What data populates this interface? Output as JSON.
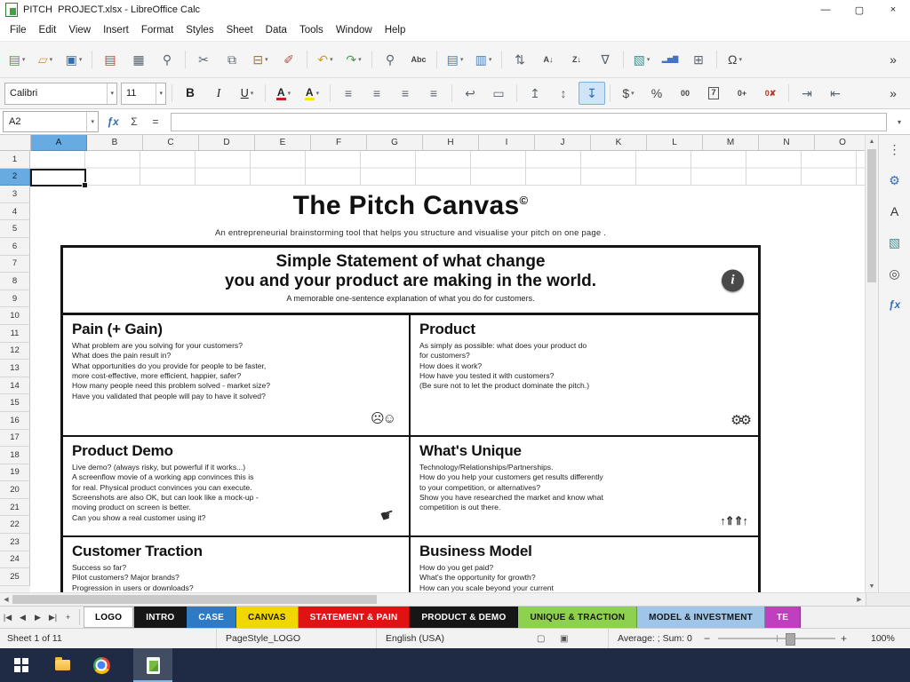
{
  "window": {
    "title": "PITCH  PROJECT.xlsx - LibreOffice Calc",
    "controls": {
      "minimize": "—",
      "maximize": "▢",
      "close": "×"
    }
  },
  "menubar": [
    {
      "name": "menu-file",
      "label": "File"
    },
    {
      "name": "menu-edit",
      "label": "Edit"
    },
    {
      "name": "menu-view",
      "label": "View"
    },
    {
      "name": "menu-insert",
      "label": "Insert"
    },
    {
      "name": "menu-format",
      "label": "Format"
    },
    {
      "name": "menu-styles",
      "label": "Styles"
    },
    {
      "name": "menu-sheet",
      "label": "Sheet"
    },
    {
      "name": "menu-data",
      "label": "Data"
    },
    {
      "name": "menu-tools",
      "label": "Tools"
    },
    {
      "name": "menu-window",
      "label": "Window"
    },
    {
      "name": "menu-help",
      "label": "Help"
    }
  ],
  "toolbar_standard": [
    {
      "name": "new-document-button",
      "glyph": "▤",
      "color": "#4a9e4a",
      "drop": true
    },
    {
      "name": "open-file-button",
      "glyph": "▱",
      "color": "#d69a3c",
      "drop": true
    },
    {
      "name": "save-button",
      "glyph": "▣",
      "color": "#2f6fb5",
      "drop": true
    },
    {
      "name": "toolbar-separator",
      "sep": true
    },
    {
      "name": "export-pdf-button",
      "glyph": "▤",
      "color": "#cc3b2f"
    },
    {
      "name": "print-button",
      "glyph": "▦",
      "color": "#5a6570"
    },
    {
      "name": "print-preview-button",
      "glyph": "⚲",
      "color": "#5a6570"
    },
    {
      "name": "toolbar-separator",
      "sep": true
    },
    {
      "name": "cut-button",
      "glyph": "✂",
      "color": "#5a6570"
    },
    {
      "name": "copy-button",
      "glyph": "⧉",
      "color": "#5a6570"
    },
    {
      "name": "paste-button",
      "glyph": "⊟",
      "color": "#9a7b4f",
      "drop": true
    },
    {
      "name": "clone-formatting-button",
      "glyph": "✐",
      "color": "#b0564f"
    },
    {
      "name": "toolbar-separator",
      "sep": true
    },
    {
      "name": "undo-button",
      "glyph": "↶",
      "color": "#d09c20",
      "drop": true
    },
    {
      "name": "redo-button",
      "glyph": "↷",
      "color": "#4a9e4a",
      "drop": true
    },
    {
      "name": "toolbar-separator",
      "sep": true
    },
    {
      "name": "find-replace-button",
      "glyph": "⚲",
      "color": "#5a6570"
    },
    {
      "name": "spelling-button",
      "glyph": "Abc",
      "cls": "sm",
      "color": "#444444"
    },
    {
      "name": "toolbar-separator",
      "sep": true
    },
    {
      "name": "insert-row-button",
      "glyph": "▤",
      "color": "#4a7fb8",
      "drop": true
    },
    {
      "name": "insert-column-button",
      "glyph": "▥",
      "color": "#4a7fb8",
      "drop": true
    },
    {
      "name": "toolbar-separator",
      "sep": true
    },
    {
      "name": "sort-button",
      "glyph": "⇅",
      "color": "#5a6570"
    },
    {
      "name": "sort-ascending-button",
      "glyph": "A↓",
      "cls": "sm",
      "color": "#444444"
    },
    {
      "name": "sort-descending-button",
      "glyph": "Z↓",
      "cls": "sm",
      "color": "#444444"
    },
    {
      "name": "autofilter-button",
      "glyph": "∇",
      "color": "#5a6570"
    },
    {
      "name": "toolbar-separator",
      "sep": true
    },
    {
      "name": "insert-image-button",
      "glyph": "▧",
      "color": "#3d8f8f",
      "drop": true
    },
    {
      "name": "insert-chart-button",
      "glyph": "▂▅▇",
      "cls": "chartg",
      "color": "#4472c4"
    },
    {
      "name": "insert-pivot-button",
      "glyph": "⊞",
      "color": "#5a6570"
    },
    {
      "name": "toolbar-separator",
      "sep": true
    },
    {
      "name": "special-character-button",
      "glyph": "Ω",
      "color": "#444444",
      "drop": true
    },
    {
      "name": "toolbar-overflow-button",
      "glyph": "»",
      "color": "#333333"
    }
  ],
  "toolbar_formatting": {
    "font_name": "Calibri",
    "font_size": "11",
    "buttons": [
      {
        "name": "toolbar-separator",
        "sep": true
      },
      {
        "name": "bold-button",
        "glyph": "B",
        "cls": "bg-b"
      },
      {
        "name": "italic-button",
        "glyph": "I",
        "cls": "bg-i"
      },
      {
        "name": "underline-button",
        "glyph": "U",
        "cls": "bg-u",
        "drop": true
      },
      {
        "name": "toolbar-separator",
        "sep": true
      },
      {
        "name": "font-color-button",
        "glyph": "A",
        "cls": "fc",
        "drop": true
      },
      {
        "name": "highlight-color-button",
        "glyph": "A",
        "cls": "hl",
        "drop": true
      },
      {
        "name": "toolbar-separator",
        "sep": true
      },
      {
        "name": "align-left-button",
        "glyph": "≡",
        "color": "#5a6570"
      },
      {
        "name": "align-center-button",
        "glyph": "≡",
        "color": "#5a6570"
      },
      {
        "name": "align-right-button",
        "glyph": "≡",
        "color": "#5a6570"
      },
      {
        "name": "align-justify-button",
        "glyph": "≡",
        "color": "#5a6570"
      },
      {
        "name": "toolbar-separator",
        "sep": true
      },
      {
        "name": "wrap-text-button",
        "glyph": "↩",
        "color": "#5a6570"
      },
      {
        "name": "merge-cells-button",
        "glyph": "▭",
        "color": "#5a6570"
      },
      {
        "name": "toolbar-separator",
        "sep": true
      },
      {
        "name": "align-top-button",
        "glyph": "↥",
        "color": "#5a6570"
      },
      {
        "name": "center-vertically-button",
        "glyph": "↕",
        "color": "#5a6570"
      },
      {
        "name": "align-bottom-button",
        "glyph": "↧",
        "color": "#2f6fb5",
        "active": true
      },
      {
        "name": "toolbar-separator",
        "sep": true
      },
      {
        "name": "format-currency-button",
        "glyph": "$",
        "color": "#444444",
        "drop": true
      },
      {
        "name": "format-percent-button",
        "glyph": "%",
        "color": "#444444"
      },
      {
        "name": "format-number-button",
        "glyph": "00",
        "cls": "sm",
        "color": "#444444"
      },
      {
        "name": "format-date-button",
        "glyph": "7",
        "cls": "boxed",
        "color": "#444444"
      },
      {
        "name": "add-decimal-button",
        "glyph": "0+",
        "cls": "sm",
        "color": "#444444"
      },
      {
        "name": "delete-decimal-button",
        "glyph": "0✘",
        "cls": "sm",
        "color": "#b03a2e"
      },
      {
        "name": "toolbar-separator",
        "sep": true
      },
      {
        "name": "increase-indent-button",
        "glyph": "⇥",
        "color": "#5a6570"
      },
      {
        "name": "decrease-indent-button",
        "glyph": "⇤",
        "color": "#5a6570"
      },
      {
        "name": "toolbar-overflow-button",
        "glyph": "»",
        "color": "#333333"
      }
    ]
  },
  "formula_bar": {
    "name_box": "A2",
    "formula": "",
    "icons": {
      "dropdown": "▾",
      "function_wizard": "ƒx",
      "sum": "Σ",
      "equals": "=",
      "expand": "▾"
    }
  },
  "grid": {
    "columns": [
      {
        "label": "A",
        "active": true
      },
      {
        "label": "B"
      },
      {
        "label": "C"
      },
      {
        "label": "D"
      },
      {
        "label": "E"
      },
      {
        "label": "F"
      },
      {
        "label": "G"
      },
      {
        "label": "H"
      },
      {
        "label": "I"
      },
      {
        "label": "J"
      },
      {
        "label": "K"
      },
      {
        "label": "L"
      },
      {
        "label": "M"
      },
      {
        "label": "N"
      },
      {
        "label": "O"
      }
    ],
    "rows": [
      {
        "label": "1"
      },
      {
        "label": "2",
        "active": true
      },
      {
        "label": "3"
      },
      {
        "label": "4"
      },
      {
        "label": "5"
      },
      {
        "label": "6"
      },
      {
        "label": "7"
      },
      {
        "label": "8"
      },
      {
        "label": "9"
      },
      {
        "label": "10"
      },
      {
        "label": "11"
      },
      {
        "label": "12"
      },
      {
        "label": "13"
      },
      {
        "label": "14"
      },
      {
        "label": "15"
      },
      {
        "label": "16"
      },
      {
        "label": "17"
      },
      {
        "label": "18"
      },
      {
        "label": "19"
      },
      {
        "label": "20"
      },
      {
        "label": "21"
      },
      {
        "label": "22"
      },
      {
        "label": "23"
      },
      {
        "label": "24"
      },
      {
        "label": "25"
      }
    ]
  },
  "canvas": {
    "title": "The Pitch Canvas",
    "copyright": "©",
    "subtitle": "An entrepreneurial brainstorming tool that helps you structure and visualise your pitch on one page .",
    "statement_title": "Simple Statement of what change\nyou and your product are making in the world.",
    "statement_sub": "A memorable one-sentence explanation of what you do for customers.",
    "icons": {
      "info": "i",
      "masks": "☹☺",
      "gears": "⚙⚙",
      "click": "☛",
      "arrows": "↑⇑⇑↑"
    },
    "sections": [
      {
        "title": "Pain (+ Gain)",
        "body": "What problem are you solving for your customers?\nWhat does the pain result in?\nWhat opportunities do you provide for people to be faster,\nmore cost-effective, more efficient, happier, safer?\nHow many people need this problem solved - market size?\nHave you validated that people will pay to have it solved?"
      },
      {
        "title": "Product",
        "body": "As simply as possible: what does your product do\nfor customers?\nHow does it work?\nHow have you tested it with customers?\n(Be sure not to let the product dominate the pitch.)"
      },
      {
        "title": "Product Demo",
        "body": "Live demo? (always risky, but powerful if it works...)\nA screenflow movie of a working app convinces this is\nfor real. Physical product convinces you can execute.\nScreenshots are also OK, but can look like a mock-up -\nmoving product on screen is better.\nCan you show a real customer using it?"
      },
      {
        "title": "What's Unique",
        "body": "Technology/Relationships/Partnerships.\nHow do you help your customers get results differently\nto your competition, or alternatives?\nShow you have researched the market and know what\ncompetition is out there."
      },
      {
        "title": "Customer Traction",
        "body": "Success so far?\nPilot customers? Major brands?\nProgression in users or downloads?"
      },
      {
        "title": "Business Model",
        "body": "How do you get paid?\nWhat's the opportunity for growth?\nHow can you scale beyond your current"
      }
    ]
  },
  "sheet_tabs": {
    "nav": [
      {
        "name": "first-sheet-button",
        "glyph": "|◀"
      },
      {
        "name": "previous-sheet-button",
        "glyph": "◀"
      },
      {
        "name": "next-sheet-button",
        "glyph": "▶"
      },
      {
        "name": "last-sheet-button",
        "glyph": "▶|"
      },
      {
        "name": "add-sheet-button",
        "glyph": "+"
      }
    ],
    "tabs": [
      {
        "name": "sheet-tab-logo",
        "label": "LOGO",
        "bg": "#ffffff",
        "fg": "#000000",
        "active": true
      },
      {
        "name": "sheet-tab-intro",
        "label": "INTRO",
        "bg": "#161616",
        "fg": "#ffffff"
      },
      {
        "name": "sheet-tab-case",
        "label": "CASE",
        "bg": "#2d7bc4",
        "fg": "#ffffff"
      },
      {
        "name": "sheet-tab-canvas",
        "label": "CANVAS",
        "bg": "#f2d600",
        "fg": "#161616"
      },
      {
        "name": "sheet-tab-statement-pain",
        "label": "STATEMENT & PAIN",
        "bg": "#e01212",
        "fg": "#ffffff"
      },
      {
        "name": "sheet-tab-product-demo",
        "label": "PRODUCT & DEMO",
        "bg": "#161616",
        "fg": "#ffffff"
      },
      {
        "name": "sheet-tab-unique-traction",
        "label": "UNIQUE & TRACTION",
        "bg": "#8ed14e",
        "fg": "#161616"
      },
      {
        "name": "sheet-tab-model-investment",
        "label": "MODEL & INVESTMENT",
        "bg": "#9fc5e8",
        "fg": "#161616"
      },
      {
        "name": "sheet-tab-te",
        "label": "TE",
        "bg": "#c03fc0",
        "fg": "#ffffff"
      }
    ]
  },
  "status_bar": {
    "sheet_info": "Sheet 1 of 11",
    "page_style": "PageStyle_LOGO",
    "language": "English (USA)",
    "stats": "Average: ; Sum: 0",
    "zoom": "100%",
    "icons": {
      "selection_mode": "▢",
      "modified": "▣",
      "zoom_out": "−",
      "zoom_in": "+"
    }
  },
  "sidebar": {
    "icons": [
      {
        "name": "sidebar-settings-icon",
        "glyph": "⋮",
        "color": "#444444"
      },
      {
        "name": "properties-deck-icon",
        "glyph": "⚙",
        "color": "#2f6fb5"
      },
      {
        "name": "styles-deck-icon",
        "glyph": "A",
        "color": "#333333"
      },
      {
        "name": "gallery-deck-icon",
        "glyph": "▧",
        "color": "#3d8f8f"
      },
      {
        "name": "navigator-deck-icon",
        "glyph": "◎",
        "color": "#444444"
      },
      {
        "name": "functions-deck-icon",
        "glyph": "ƒx",
        "cls": "fx",
        "color": "#2f6fb5"
      }
    ]
  },
  "scrollbars": {
    "up": "▲",
    "down": "▼",
    "left": "◀",
    "right": "▶"
  }
}
